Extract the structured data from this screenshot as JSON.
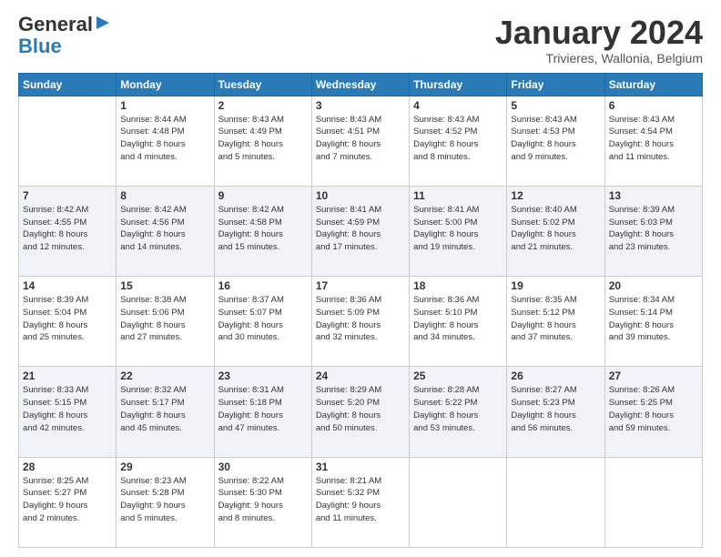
{
  "logo": {
    "general": "General",
    "blue": "Blue"
  },
  "header": {
    "month": "January 2024",
    "location": "Trivieres, Wallonia, Belgium"
  },
  "weekdays": [
    "Sunday",
    "Monday",
    "Tuesday",
    "Wednesday",
    "Thursday",
    "Friday",
    "Saturday"
  ],
  "weeks": [
    [
      {
        "day": "",
        "info": ""
      },
      {
        "day": "1",
        "info": "Sunrise: 8:44 AM\nSunset: 4:48 PM\nDaylight: 8 hours\nand 4 minutes."
      },
      {
        "day": "2",
        "info": "Sunrise: 8:43 AM\nSunset: 4:49 PM\nDaylight: 8 hours\nand 5 minutes."
      },
      {
        "day": "3",
        "info": "Sunrise: 8:43 AM\nSunset: 4:51 PM\nDaylight: 8 hours\nand 7 minutes."
      },
      {
        "day": "4",
        "info": "Sunrise: 8:43 AM\nSunset: 4:52 PM\nDaylight: 8 hours\nand 8 minutes."
      },
      {
        "day": "5",
        "info": "Sunrise: 8:43 AM\nSunset: 4:53 PM\nDaylight: 8 hours\nand 9 minutes."
      },
      {
        "day": "6",
        "info": "Sunrise: 8:43 AM\nSunset: 4:54 PM\nDaylight: 8 hours\nand 11 minutes."
      }
    ],
    [
      {
        "day": "7",
        "info": "Sunrise: 8:42 AM\nSunset: 4:55 PM\nDaylight: 8 hours\nand 12 minutes."
      },
      {
        "day": "8",
        "info": "Sunrise: 8:42 AM\nSunset: 4:56 PM\nDaylight: 8 hours\nand 14 minutes."
      },
      {
        "day": "9",
        "info": "Sunrise: 8:42 AM\nSunset: 4:58 PM\nDaylight: 8 hours\nand 15 minutes."
      },
      {
        "day": "10",
        "info": "Sunrise: 8:41 AM\nSunset: 4:59 PM\nDaylight: 8 hours\nand 17 minutes."
      },
      {
        "day": "11",
        "info": "Sunrise: 8:41 AM\nSunset: 5:00 PM\nDaylight: 8 hours\nand 19 minutes."
      },
      {
        "day": "12",
        "info": "Sunrise: 8:40 AM\nSunset: 5:02 PM\nDaylight: 8 hours\nand 21 minutes."
      },
      {
        "day": "13",
        "info": "Sunrise: 8:39 AM\nSunset: 5:03 PM\nDaylight: 8 hours\nand 23 minutes."
      }
    ],
    [
      {
        "day": "14",
        "info": "Sunrise: 8:39 AM\nSunset: 5:04 PM\nDaylight: 8 hours\nand 25 minutes."
      },
      {
        "day": "15",
        "info": "Sunrise: 8:38 AM\nSunset: 5:06 PM\nDaylight: 8 hours\nand 27 minutes."
      },
      {
        "day": "16",
        "info": "Sunrise: 8:37 AM\nSunset: 5:07 PM\nDaylight: 8 hours\nand 30 minutes."
      },
      {
        "day": "17",
        "info": "Sunrise: 8:36 AM\nSunset: 5:09 PM\nDaylight: 8 hours\nand 32 minutes."
      },
      {
        "day": "18",
        "info": "Sunrise: 8:36 AM\nSunset: 5:10 PM\nDaylight: 8 hours\nand 34 minutes."
      },
      {
        "day": "19",
        "info": "Sunrise: 8:35 AM\nSunset: 5:12 PM\nDaylight: 8 hours\nand 37 minutes."
      },
      {
        "day": "20",
        "info": "Sunrise: 8:34 AM\nSunset: 5:14 PM\nDaylight: 8 hours\nand 39 minutes."
      }
    ],
    [
      {
        "day": "21",
        "info": "Sunrise: 8:33 AM\nSunset: 5:15 PM\nDaylight: 8 hours\nand 42 minutes."
      },
      {
        "day": "22",
        "info": "Sunrise: 8:32 AM\nSunset: 5:17 PM\nDaylight: 8 hours\nand 45 minutes."
      },
      {
        "day": "23",
        "info": "Sunrise: 8:31 AM\nSunset: 5:18 PM\nDaylight: 8 hours\nand 47 minutes."
      },
      {
        "day": "24",
        "info": "Sunrise: 8:29 AM\nSunset: 5:20 PM\nDaylight: 8 hours\nand 50 minutes."
      },
      {
        "day": "25",
        "info": "Sunrise: 8:28 AM\nSunset: 5:22 PM\nDaylight: 8 hours\nand 53 minutes."
      },
      {
        "day": "26",
        "info": "Sunrise: 8:27 AM\nSunset: 5:23 PM\nDaylight: 8 hours\nand 56 minutes."
      },
      {
        "day": "27",
        "info": "Sunrise: 8:26 AM\nSunset: 5:25 PM\nDaylight: 8 hours\nand 59 minutes."
      }
    ],
    [
      {
        "day": "28",
        "info": "Sunrise: 8:25 AM\nSunset: 5:27 PM\nDaylight: 9 hours\nand 2 minutes."
      },
      {
        "day": "29",
        "info": "Sunrise: 8:23 AM\nSunset: 5:28 PM\nDaylight: 9 hours\nand 5 minutes."
      },
      {
        "day": "30",
        "info": "Sunrise: 8:22 AM\nSunset: 5:30 PM\nDaylight: 9 hours\nand 8 minutes."
      },
      {
        "day": "31",
        "info": "Sunrise: 8:21 AM\nSunset: 5:32 PM\nDaylight: 9 hours\nand 11 minutes."
      },
      {
        "day": "",
        "info": ""
      },
      {
        "day": "",
        "info": ""
      },
      {
        "day": "",
        "info": ""
      }
    ]
  ]
}
